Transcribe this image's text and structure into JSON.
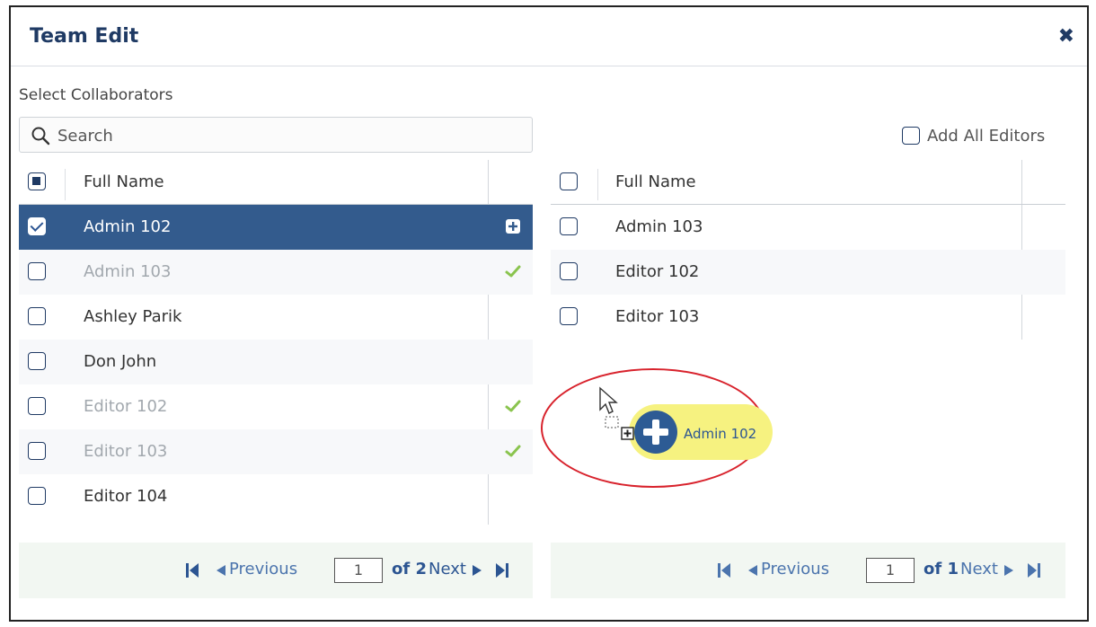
{
  "dialog": {
    "title": "Team Edit",
    "close_icon": "close-icon"
  },
  "section_label": "Select Collaborators",
  "search": {
    "placeholder": "Search",
    "value": ""
  },
  "add_all_editors": {
    "label": "Add All Editors",
    "checked": false
  },
  "left_table": {
    "header": "Full Name",
    "rows": [
      {
        "name": "Admin 102",
        "checked": true,
        "selected": true,
        "added": false,
        "action_icon": "plus-square-icon"
      },
      {
        "name": "Admin 103",
        "checked": false,
        "selected": false,
        "added": true,
        "action_icon": "check-icon"
      },
      {
        "name": "Ashley Parik",
        "checked": false,
        "selected": false,
        "added": false
      },
      {
        "name": "Don John",
        "checked": false,
        "selected": false,
        "added": false
      },
      {
        "name": "Editor 102",
        "checked": false,
        "selected": false,
        "added": true,
        "action_icon": "check-icon"
      },
      {
        "name": "Editor 103",
        "checked": false,
        "selected": false,
        "added": true,
        "action_icon": "check-icon"
      },
      {
        "name": "Editor 104",
        "checked": false,
        "selected": false,
        "added": false
      }
    ]
  },
  "right_table": {
    "header": "Full Name",
    "rows": [
      {
        "name": "Admin 103",
        "checked": false
      },
      {
        "name": "Editor 102",
        "checked": false
      },
      {
        "name": "Editor 103",
        "checked": false
      }
    ]
  },
  "left_pager": {
    "previous": "Previous",
    "page": "1",
    "of": "of 2",
    "next": "Next"
  },
  "right_pager": {
    "previous": "Previous",
    "page": "1",
    "of": "of 1",
    "next": "Next"
  },
  "drag_chip": {
    "label": "Admin 102",
    "icon": "plus-circle-icon"
  },
  "colors": {
    "primary": "#1f3a64",
    "selected_row": "#335b8d",
    "check_green": "#8ac44e",
    "chip_yellow": "#f6f280",
    "highlight_red": "#d8222c",
    "pager_bg": "#f2f7f2"
  }
}
